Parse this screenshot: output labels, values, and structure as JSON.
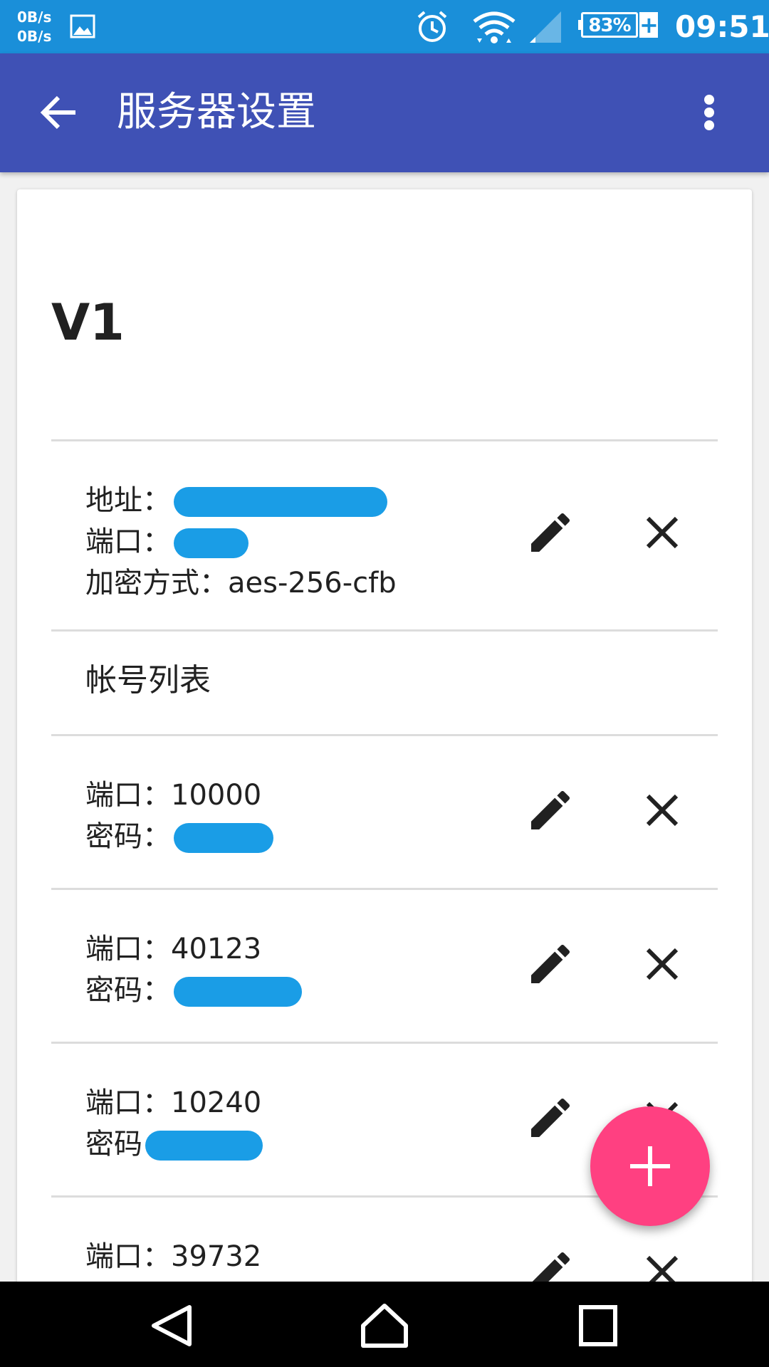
{
  "status_bar": {
    "net_up": "0B/s",
    "net_down": "0B/s",
    "battery_percent": "83%",
    "charging_symbol": "+",
    "time": "09:51"
  },
  "app_bar": {
    "title": "服务器设置"
  },
  "server": {
    "name": "V1",
    "address_label": "地址：",
    "port_label": "端口：",
    "encryption_label": "加密方式：",
    "encryption_value": "aes-256-cfb"
  },
  "accounts": {
    "header": "帐号列表",
    "port_label": "端口：",
    "password_label": "密码：",
    "password_label_alt": "密码",
    "items": [
      {
        "port": "10000"
      },
      {
        "port": "40123"
      },
      {
        "port": "10240"
      },
      {
        "port": "39732"
      }
    ]
  },
  "colors": {
    "status_bar": "#1a8fd9",
    "app_bar": "#3f51b5",
    "fab": "#ff4081",
    "redaction": "#1a9de6"
  }
}
